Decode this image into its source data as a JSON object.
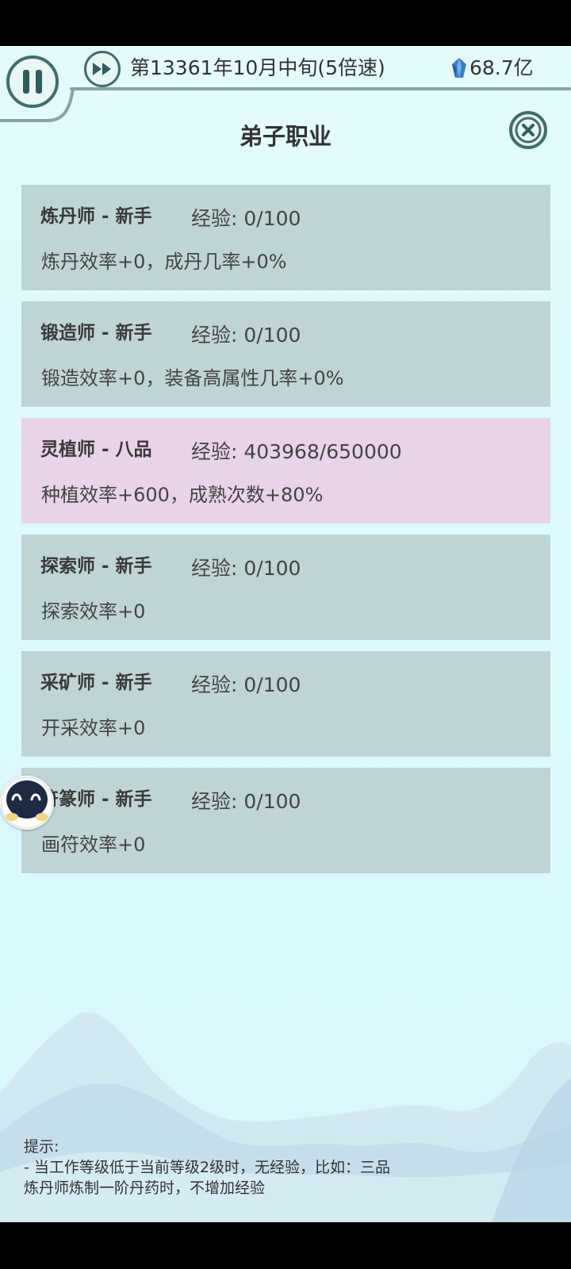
{
  "header": {
    "date": "第13361年10月中旬(5倍速)",
    "spirit_stones": "68.7亿"
  },
  "page": {
    "title": "弟子职业"
  },
  "professions": [
    {
      "name": "炼丹师 - 新手",
      "exp": "经验: 0/100",
      "desc": "炼丹效率+0，成丹几率+0%",
      "highlight": false
    },
    {
      "name": "锻造师 - 新手",
      "exp": "经验: 0/100",
      "desc": "锻造效率+0，装备高属性几率+0%",
      "highlight": false
    },
    {
      "name": "灵植师 - 八品",
      "exp": "经验: 403968/650000",
      "desc": "种植效率+600，成熟次数+80%",
      "highlight": true
    },
    {
      "name": "探索师 - 新手",
      "exp": "经验: 0/100",
      "desc": "探索效率+0",
      "highlight": false
    },
    {
      "name": "采矿师 - 新手",
      "exp": "经验: 0/100",
      "desc": "开采效率+0",
      "highlight": false
    },
    {
      "name": "符篆师 - 新手",
      "exp": "经验: 0/100",
      "desc": "画符效率+0",
      "highlight": false
    }
  ],
  "tips": {
    "heading": "提示:",
    "line1": "- 当工作等级低于当前等级2级时，无经验，比如：三品",
    "line2": "炼丹师炼制一阶丹药时，不增加经验"
  },
  "colors": {
    "card_default": "#bfd4d5",
    "card_highlight": "#e8d3e8",
    "accent": "#3f6e6e",
    "background": "#dcfafd"
  },
  "icons": {
    "pause": "pause-icon",
    "fast_forward": "fast-forward-icon",
    "gem": "spirit-stone-icon",
    "close": "close-icon",
    "assistant": "assistant-face-icon"
  }
}
